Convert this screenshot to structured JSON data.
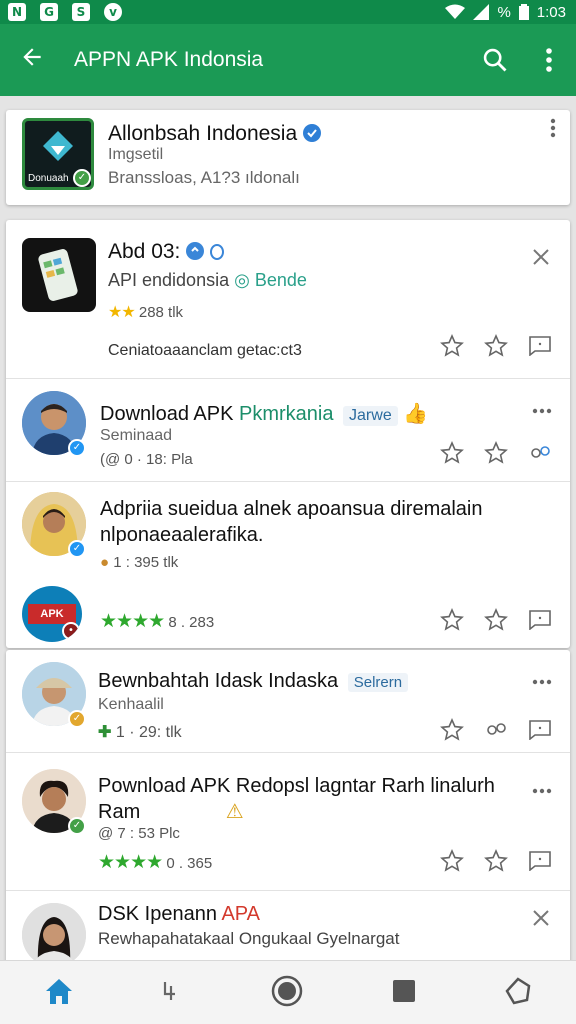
{
  "status": {
    "left_icons": [
      "N",
      "G",
      "S",
      "v"
    ],
    "battery_text": "%",
    "time": "1:03"
  },
  "appbar": {
    "title": "APPN APK Indonsia"
  },
  "featured": {
    "name": "Allonbsah Indonesia",
    "sub1": "Imgsetil",
    "sub2": "Branssloas, A1?3 ıldonalı",
    "logo_text": "Donuaah"
  },
  "card2": {
    "header": {
      "name": "Abd 03: ",
      "sub": "API endidonsia",
      "chip": "Bende",
      "rating": "288 tlk",
      "desc": "Ceniatoaaanclam getac:ct3"
    },
    "items": [
      {
        "title": "Download APK ",
        "title_accent": "Pkmrkania",
        "chip": "Jarwe",
        "sub": "Seminaad",
        "meta": "(@ 0 · 18: Pla"
      },
      {
        "title": "Adpriia sueidua alnek apoansua diremalain",
        "title2": "nlponaeaalerafika.",
        "meta": "1 : 395 tlk",
        "rating": "8 . 283"
      }
    ]
  },
  "card3": {
    "items": [
      {
        "title": "Bewnbahtah Idask Indaska",
        "chip": "Selrern",
        "sub": "Kenhaalil",
        "meta": "1 · 29: tlk"
      },
      {
        "title": "Pownload APK Redopsl lagntar Rarh linalurh",
        "title2": "Ram",
        "meta": "@ 7 : 53 Plc",
        "rating": "0 . 365"
      },
      {
        "title": "DSK Ipenann ",
        "title_accent": "APA",
        "sub": "Rewhapahatakaal Ongukaal Gyelnargat"
      }
    ]
  },
  "colors": {
    "appbar": "#1b9a55",
    "statusbar": "#0f8a4a",
    "accent_blue": "#2196f3",
    "verified_green": "#43a047"
  }
}
